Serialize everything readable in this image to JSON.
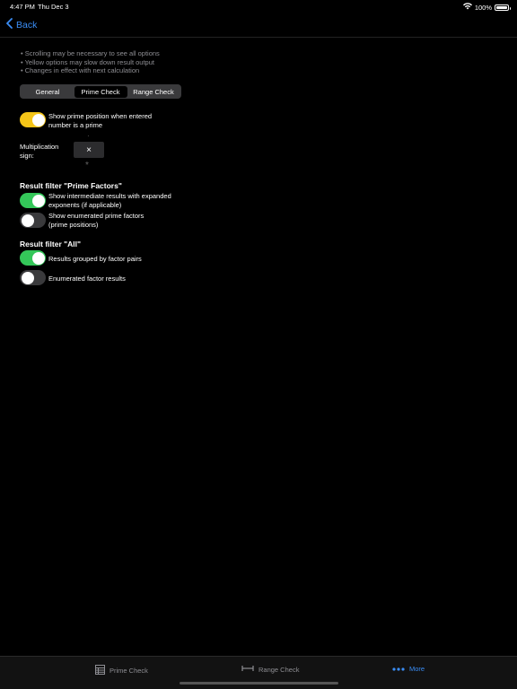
{
  "status": {
    "time": "4:47 PM",
    "date": "Thu Dec 3",
    "battery": "100%"
  },
  "nav": {
    "back_label": "Back"
  },
  "hints": [
    "Scrolling may be necessary to see all options",
    "Yellow options may slow down result output",
    "Changes in effect with next calculation"
  ],
  "segments": {
    "general": "General",
    "prime_check": "Prime Check",
    "range_check": "Range Check",
    "selected": "Prime Check"
  },
  "prime_position": {
    "label_line1": "Show prime position when entered",
    "label_line2": "number is a prime",
    "on": true,
    "color": "#f5c518"
  },
  "multiplication": {
    "label_line1": "Multiplication",
    "label_line2": "sign:",
    "above": "·",
    "selected": "×",
    "below": "*"
  },
  "prime_factors": {
    "title": "Result filter \"Prime Factors\"",
    "intermediate": {
      "line1": "Show intermediate results with expanded",
      "line2": "exponents (if applicable)",
      "on": true
    },
    "enumerated": {
      "line1": "Show enumerated prime factors",
      "line2": "(prime positions)",
      "on": false
    }
  },
  "all_filter": {
    "title": "Result filter \"All\"",
    "grouped": {
      "label": "Results grouped by factor pairs",
      "on": true
    },
    "enumerated": {
      "label": "Enumerated factor results",
      "on": false
    }
  },
  "tabs": {
    "prime_check": "Prime Check",
    "range_check": "Range Check",
    "more": "More"
  },
  "colors": {
    "accent": "#3a8df5",
    "toggle_on": "#34c759",
    "toggle_yellow": "#f5c518"
  }
}
